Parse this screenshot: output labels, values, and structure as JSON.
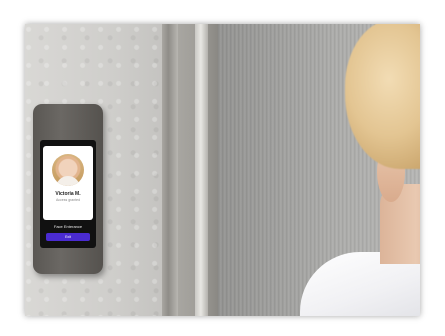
{
  "device_screen": {
    "name": "Victoria M.",
    "subtitle": "Access granted",
    "status": "Face Enterance",
    "button_label": "Exit"
  },
  "colors": {
    "button": "#4a2bd1",
    "wall": "#d2d1ce",
    "door": "#a5a5a3"
  }
}
